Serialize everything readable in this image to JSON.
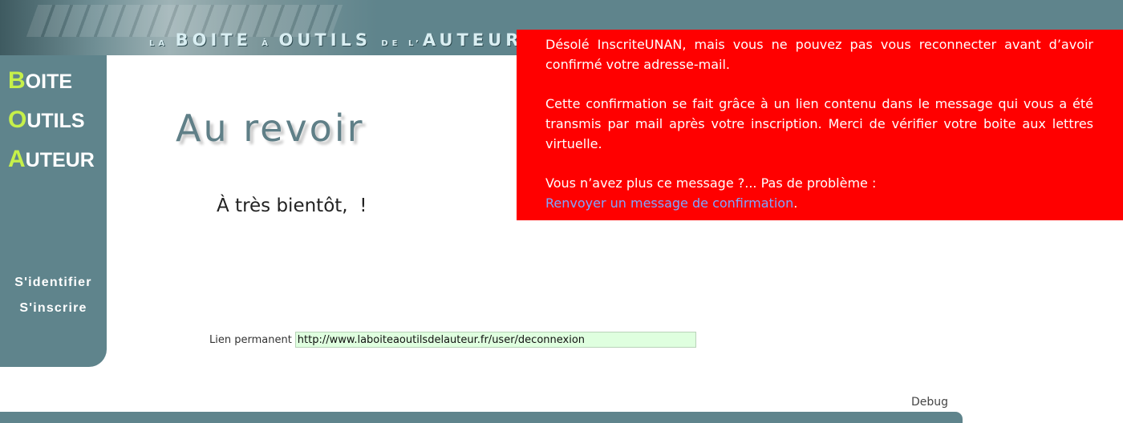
{
  "header": {
    "title_parts": [
      {
        "text": "la ",
        "size": "small"
      },
      {
        "text": "boite ",
        "size": "big"
      },
      {
        "text": "à ",
        "size": "small"
      },
      {
        "text": "outils ",
        "size": "big"
      },
      {
        "text": "de l’",
        "size": "small"
      },
      {
        "text": "auteur",
        "size": "big"
      }
    ]
  },
  "sidebar": {
    "logo": [
      {
        "initial": "B",
        "rest": "OITE"
      },
      {
        "initial": "O",
        "rest": "UTILS"
      },
      {
        "initial": "A",
        "rest": "UTEUR"
      }
    ],
    "nav": {
      "login": "S'identifier",
      "signup": "S'inscrire"
    }
  },
  "main": {
    "heading": "Au revoir",
    "farewell": "À très bientôt,  !",
    "permalink": {
      "label": "Lien permanent",
      "value": "http://www.laboiteaoutilsdelauteur.fr/user/deconnexion"
    }
  },
  "alert": {
    "paragraph1": "Désolé InscriteUNAN, mais vous ne pouvez pas vous reconnecter avant d’avoir confirmé votre adresse-mail.",
    "paragraph2": "Cette confirmation se fait grâce à un lien contenu dans le message qui vous a été transmis par mail après votre inscription. Merci de vérifier votre boite aux lettres virtuelle.",
    "question": "Vous n’avez plus ce message ?... Pas de problème :",
    "link": "Renvoyer un message de confirmation",
    "link_suffix": ".",
    "background_color": "#ff0000"
  },
  "footer": {
    "debug": "Debug"
  },
  "colors": {
    "brand_teal": "#5f848c",
    "logo_accent": "#c6f04a",
    "link_blue": "#7fa6ff",
    "permalink_bg": "#dfffdf"
  }
}
